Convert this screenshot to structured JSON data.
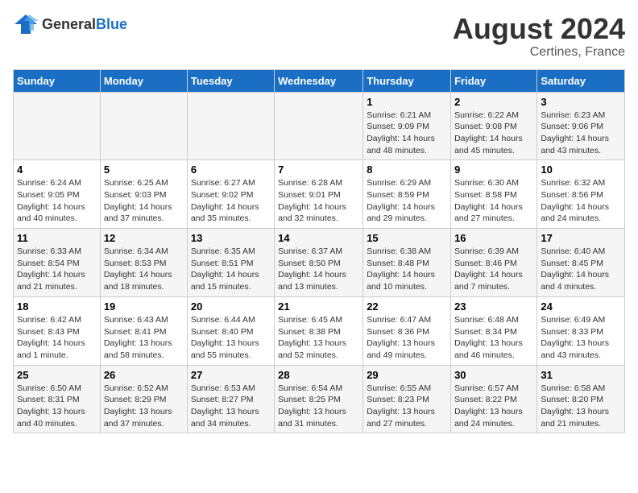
{
  "logo": {
    "general": "General",
    "blue": "Blue"
  },
  "title": "August 2024",
  "location": "Certines, France",
  "days_of_week": [
    "Sunday",
    "Monday",
    "Tuesday",
    "Wednesday",
    "Thursday",
    "Friday",
    "Saturday"
  ],
  "weeks": [
    [
      {
        "day": "",
        "info": ""
      },
      {
        "day": "",
        "info": ""
      },
      {
        "day": "",
        "info": ""
      },
      {
        "day": "",
        "info": ""
      },
      {
        "day": "1",
        "info": "Sunrise: 6:21 AM\nSunset: 9:09 PM\nDaylight: 14 hours and 48 minutes."
      },
      {
        "day": "2",
        "info": "Sunrise: 6:22 AM\nSunset: 9:08 PM\nDaylight: 14 hours and 45 minutes."
      },
      {
        "day": "3",
        "info": "Sunrise: 6:23 AM\nSunset: 9:06 PM\nDaylight: 14 hours and 43 minutes."
      }
    ],
    [
      {
        "day": "4",
        "info": "Sunrise: 6:24 AM\nSunset: 9:05 PM\nDaylight: 14 hours and 40 minutes."
      },
      {
        "day": "5",
        "info": "Sunrise: 6:25 AM\nSunset: 9:03 PM\nDaylight: 14 hours and 37 minutes."
      },
      {
        "day": "6",
        "info": "Sunrise: 6:27 AM\nSunset: 9:02 PM\nDaylight: 14 hours and 35 minutes."
      },
      {
        "day": "7",
        "info": "Sunrise: 6:28 AM\nSunset: 9:01 PM\nDaylight: 14 hours and 32 minutes."
      },
      {
        "day": "8",
        "info": "Sunrise: 6:29 AM\nSunset: 8:59 PM\nDaylight: 14 hours and 29 minutes."
      },
      {
        "day": "9",
        "info": "Sunrise: 6:30 AM\nSunset: 8:58 PM\nDaylight: 14 hours and 27 minutes."
      },
      {
        "day": "10",
        "info": "Sunrise: 6:32 AM\nSunset: 8:56 PM\nDaylight: 14 hours and 24 minutes."
      }
    ],
    [
      {
        "day": "11",
        "info": "Sunrise: 6:33 AM\nSunset: 8:54 PM\nDaylight: 14 hours and 21 minutes."
      },
      {
        "day": "12",
        "info": "Sunrise: 6:34 AM\nSunset: 8:53 PM\nDaylight: 14 hours and 18 minutes."
      },
      {
        "day": "13",
        "info": "Sunrise: 6:35 AM\nSunset: 8:51 PM\nDaylight: 14 hours and 15 minutes."
      },
      {
        "day": "14",
        "info": "Sunrise: 6:37 AM\nSunset: 8:50 PM\nDaylight: 14 hours and 13 minutes."
      },
      {
        "day": "15",
        "info": "Sunrise: 6:38 AM\nSunset: 8:48 PM\nDaylight: 14 hours and 10 minutes."
      },
      {
        "day": "16",
        "info": "Sunrise: 6:39 AM\nSunset: 8:46 PM\nDaylight: 14 hours and 7 minutes."
      },
      {
        "day": "17",
        "info": "Sunrise: 6:40 AM\nSunset: 8:45 PM\nDaylight: 14 hours and 4 minutes."
      }
    ],
    [
      {
        "day": "18",
        "info": "Sunrise: 6:42 AM\nSunset: 8:43 PM\nDaylight: 14 hours and 1 minute."
      },
      {
        "day": "19",
        "info": "Sunrise: 6:43 AM\nSunset: 8:41 PM\nDaylight: 13 hours and 58 minutes."
      },
      {
        "day": "20",
        "info": "Sunrise: 6:44 AM\nSunset: 8:40 PM\nDaylight: 13 hours and 55 minutes."
      },
      {
        "day": "21",
        "info": "Sunrise: 6:45 AM\nSunset: 8:38 PM\nDaylight: 13 hours and 52 minutes."
      },
      {
        "day": "22",
        "info": "Sunrise: 6:47 AM\nSunset: 8:36 PM\nDaylight: 13 hours and 49 minutes."
      },
      {
        "day": "23",
        "info": "Sunrise: 6:48 AM\nSunset: 8:34 PM\nDaylight: 13 hours and 46 minutes."
      },
      {
        "day": "24",
        "info": "Sunrise: 6:49 AM\nSunset: 8:33 PM\nDaylight: 13 hours and 43 minutes."
      }
    ],
    [
      {
        "day": "25",
        "info": "Sunrise: 6:50 AM\nSunset: 8:31 PM\nDaylight: 13 hours and 40 minutes."
      },
      {
        "day": "26",
        "info": "Sunrise: 6:52 AM\nSunset: 8:29 PM\nDaylight: 13 hours and 37 minutes."
      },
      {
        "day": "27",
        "info": "Sunrise: 6:53 AM\nSunset: 8:27 PM\nDaylight: 13 hours and 34 minutes."
      },
      {
        "day": "28",
        "info": "Sunrise: 6:54 AM\nSunset: 8:25 PM\nDaylight: 13 hours and 31 minutes."
      },
      {
        "day": "29",
        "info": "Sunrise: 6:55 AM\nSunset: 8:23 PM\nDaylight: 13 hours and 27 minutes."
      },
      {
        "day": "30",
        "info": "Sunrise: 6:57 AM\nSunset: 8:22 PM\nDaylight: 13 hours and 24 minutes."
      },
      {
        "day": "31",
        "info": "Sunrise: 6:58 AM\nSunset: 8:20 PM\nDaylight: 13 hours and 21 minutes."
      }
    ]
  ]
}
